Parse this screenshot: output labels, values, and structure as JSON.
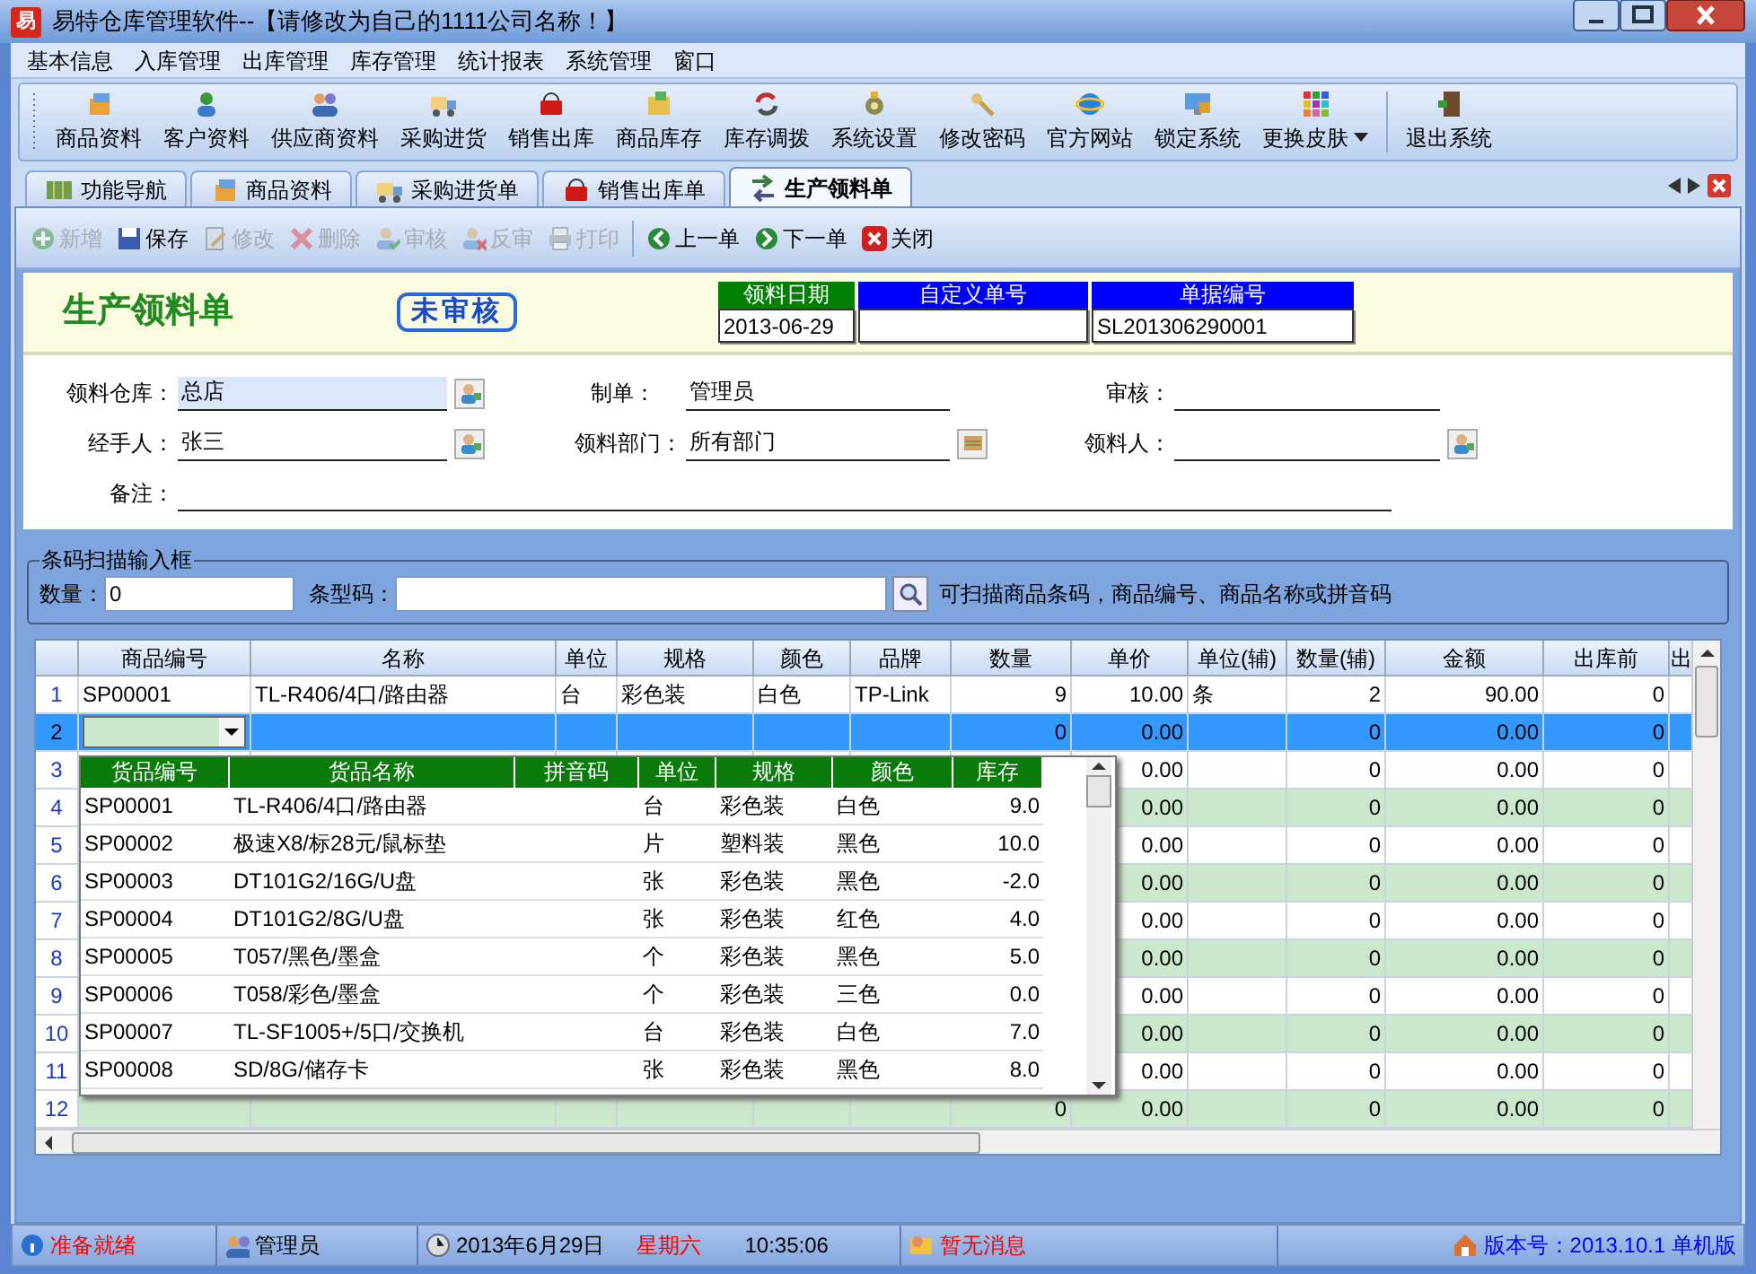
{
  "window": {
    "title": "易特仓库管理软件--【请修改为自己的1111公司名称！】",
    "logo": "易"
  },
  "menu": [
    "基本信息",
    "入库管理",
    "出库管理",
    "库存管理",
    "统计报表",
    "系统管理",
    "窗口"
  ],
  "toolbar": [
    {
      "label": "商品资料"
    },
    {
      "label": "客户资料"
    },
    {
      "label": "供应商资料"
    },
    {
      "label": "采购进货"
    },
    {
      "label": "销售出库"
    },
    {
      "label": "商品库存"
    },
    {
      "label": "库存调拨"
    },
    {
      "label": "系统设置"
    },
    {
      "label": "修改密码"
    },
    {
      "label": "官方网站"
    },
    {
      "label": "锁定系统"
    },
    {
      "label": "更换皮肤",
      "dropdown": true
    },
    {
      "label": "退出系统"
    }
  ],
  "tabs": [
    {
      "label": "功能导航",
      "selected": false
    },
    {
      "label": "商品资料",
      "selected": false
    },
    {
      "label": "采购进货单",
      "selected": false
    },
    {
      "label": "销售出库单",
      "selected": false
    },
    {
      "label": "生产领料单",
      "selected": true
    }
  ],
  "form_toolbar": [
    {
      "label": "新增",
      "disabled": true
    },
    {
      "label": "保存",
      "disabled": false
    },
    {
      "label": "修改",
      "disabled": true
    },
    {
      "label": "删除",
      "disabled": true
    },
    {
      "label": "审核",
      "disabled": true
    },
    {
      "label": "反审",
      "disabled": true
    },
    {
      "label": "打印",
      "disabled": true
    },
    {
      "label": "上一单",
      "disabled": false
    },
    {
      "label": "下一单",
      "disabled": false
    },
    {
      "label": "关闭",
      "disabled": false
    }
  ],
  "header": {
    "title": "生产领料单",
    "stamp": "未审核",
    "fields": [
      {
        "label": "领料日期",
        "value": "2013-06-29",
        "color": "#008000"
      },
      {
        "label": "自定义单号",
        "color": "#0000ff"
      },
      {
        "label": "单据编号",
        "value": "SL201306290001",
        "color": "#0000ff"
      }
    ]
  },
  "form": [
    [
      {
        "label": "领料仓库：",
        "value": "总店",
        "highlighted": true,
        "button": true
      },
      {
        "label": "制单：",
        "value": "管理员"
      },
      {
        "label": "审核："
      }
    ],
    [
      {
        "label": "经手人：",
        "value": "张三",
        "button": true
      },
      {
        "label": "领料部门：",
        "value": "所有部门",
        "button": true
      },
      {
        "label": "领料人：",
        "button": true
      }
    ],
    [
      {
        "label": "备注："
      }
    ]
  ],
  "barcode": {
    "title": "条码扫描输入框",
    "qty_label": "数量：",
    "qty": "0",
    "code_label": "条型码：",
    "hint": "可扫描商品条码，商品编号、商品名称或拼音码"
  },
  "grid": {
    "columns": [
      "商品编号",
      "名称",
      "单位",
      "规格",
      "颜色",
      "品牌",
      "数量",
      "单价",
      "单位(辅)",
      "数量(辅)",
      "金额",
      "出库前",
      "出"
    ],
    "rows": [
      {
        "num": "1",
        "selected": false,
        "cells": [
          "SP00001",
          "TL-R406/4口/路由器",
          "台",
          "彩色装",
          "白色",
          "TP-Link",
          "9",
          "10.00",
          "条",
          "2",
          "90.00",
          "0",
          null
        ]
      },
      {
        "num": "2",
        "selected": true,
        "cells": [
          null,
          null,
          null,
          null,
          null,
          null,
          "0",
          "0.00",
          null,
          "0",
          "0.00",
          "0",
          null
        ]
      },
      {
        "num": "3",
        "selected": false,
        "cells": [
          null,
          null,
          null,
          null,
          null,
          null,
          null,
          "0.00",
          null,
          "0",
          "0.00",
          "0",
          null
        ]
      },
      {
        "num": "4",
        "selected": false,
        "cells": [
          null,
          null,
          null,
          null,
          null,
          null,
          null,
          "0.00",
          null,
          "0",
          "0.00",
          "0",
          null
        ]
      },
      {
        "num": "5",
        "selected": false,
        "cells": [
          null,
          null,
          null,
          null,
          null,
          null,
          null,
          "0.00",
          null,
          "0",
          "0.00",
          "0",
          null
        ]
      },
      {
        "num": "6",
        "selected": false,
        "cells": [
          null,
          null,
          null,
          null,
          null,
          null,
          null,
          "0.00",
          null,
          "0",
          "0.00",
          "0",
          null
        ]
      },
      {
        "num": "7",
        "selected": false,
        "cells": [
          null,
          null,
          null,
          null,
          null,
          null,
          null,
          "0.00",
          null,
          "0",
          "0.00",
          "0",
          null
        ]
      },
      {
        "num": "8",
        "selected": false,
        "cells": [
          null,
          null,
          null,
          null,
          null,
          null,
          null,
          "0.00",
          null,
          "0",
          "0.00",
          "0",
          null
        ]
      },
      {
        "num": "9",
        "selected": false,
        "cells": [
          null,
          null,
          null,
          null,
          null,
          null,
          null,
          "0.00",
          null,
          "0",
          "0.00",
          "0",
          null
        ]
      },
      {
        "num": "10",
        "selected": false,
        "cells": [
          null,
          null,
          null,
          null,
          null,
          null,
          null,
          "0.00",
          null,
          "0",
          "0.00",
          "0",
          null
        ]
      },
      {
        "num": "11",
        "selected": false,
        "cells": [
          null,
          null,
          null,
          null,
          null,
          null,
          null,
          "0.00",
          null,
          "0",
          "0.00",
          "0",
          null
        ]
      },
      {
        "num": "12",
        "selected": false,
        "cells": [
          null,
          null,
          null,
          null,
          null,
          null,
          "0",
          "0.00",
          null,
          "0",
          "0.00",
          "0",
          null
        ]
      }
    ]
  },
  "dropdown": {
    "columns": [
      "货品编号",
      "货品名称",
      "拼音码",
      "单位",
      "规格",
      "颜色",
      "库存"
    ],
    "rows": [
      [
        "SP00001",
        "TL-R406/4口/路由器",
        null,
        "台",
        "彩色装",
        "白色",
        "9.0"
      ],
      [
        "SP00002",
        "极速X8/标28元/鼠标垫",
        null,
        "片",
        "塑料装",
        "黑色",
        "10.0"
      ],
      [
        "SP00003",
        "DT101G2/16G/U盘",
        null,
        "张",
        "彩色装",
        "黑色",
        "-2.0"
      ],
      [
        "SP00004",
        "DT101G2/8G/U盘",
        null,
        "张",
        "彩色装",
        "红色",
        "4.0"
      ],
      [
        "SP00005",
        "T057/黑色/墨盒",
        null,
        "个",
        "彩色装",
        "黑色",
        "5.0"
      ],
      [
        "SP00006",
        "T058/彩色/墨盒",
        null,
        "个",
        "彩色装",
        "三色",
        "0.0"
      ],
      [
        "SP00007",
        "TL-SF1005+/5口/交换机",
        null,
        "台",
        "彩色装",
        "白色",
        "7.0"
      ],
      [
        "SP00008",
        "SD/8G/储存卡",
        null,
        "张",
        "彩色装",
        "黑色",
        "8.0"
      ]
    ]
  },
  "status_bar": [
    {
      "text": "准备就绪",
      "color": "#ff0000"
    },
    {
      "text": "管理员",
      "color": "#000000"
    },
    {
      "text": "2013年6月29日",
      "color": "#000000"
    },
    {
      "text": "星期六",
      "color": "#ff0000"
    },
    {
      "text": "10:35:06",
      "color": "#000000"
    },
    {
      "text": "暂无消息",
      "color": "#ff0000"
    },
    {
      "text": "版本号：2013.10.1 单机版",
      "color": "#0000ff"
    }
  ]
}
